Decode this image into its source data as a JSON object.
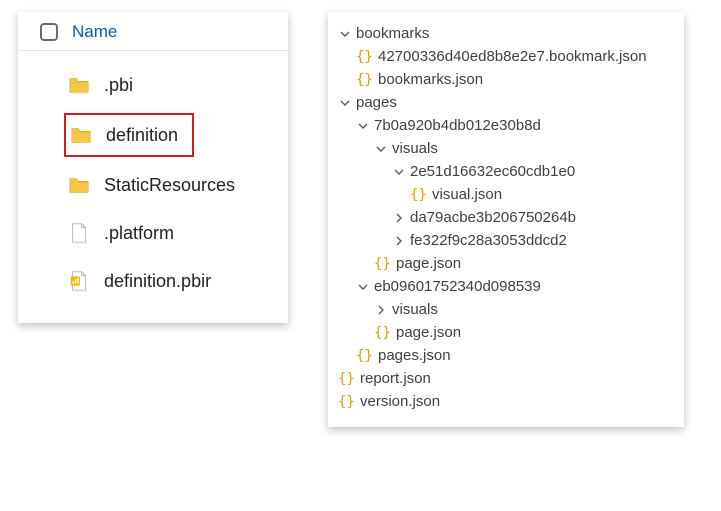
{
  "explorer": {
    "column_header": "Name",
    "items": [
      {
        "name": ".pbi",
        "icon": "folder",
        "highlighted": false
      },
      {
        "name": "definition",
        "icon": "folder",
        "highlighted": true
      },
      {
        "name": "StaticResources",
        "icon": "folder",
        "highlighted": false
      },
      {
        "name": ".platform",
        "icon": "file",
        "highlighted": false
      },
      {
        "name": "definition.pbir",
        "icon": "pbir",
        "highlighted": false
      }
    ]
  },
  "tree": [
    {
      "indent": 0,
      "type": "folder",
      "state": "open",
      "label": "bookmarks"
    },
    {
      "indent": 1,
      "type": "json",
      "label": "42700336d40ed8b8e2e7.bookmark.json"
    },
    {
      "indent": 1,
      "type": "json",
      "label": "bookmarks.json"
    },
    {
      "indent": 0,
      "type": "folder",
      "state": "open",
      "label": "pages"
    },
    {
      "indent": 1,
      "type": "folder",
      "state": "open",
      "label": "7b0a920b4db012e30b8d"
    },
    {
      "indent": 2,
      "type": "folder",
      "state": "open",
      "label": "visuals"
    },
    {
      "indent": 3,
      "type": "folder",
      "state": "open",
      "label": "2e51d16632ec60cdb1e0"
    },
    {
      "indent": 4,
      "type": "json",
      "label": "visual.json"
    },
    {
      "indent": 3,
      "type": "folder",
      "state": "closed",
      "label": "da79acbe3b206750264b"
    },
    {
      "indent": 3,
      "type": "folder",
      "state": "closed",
      "label": "fe322f9c28a3053ddcd2"
    },
    {
      "indent": 2,
      "type": "json",
      "label": "page.json"
    },
    {
      "indent": 1,
      "type": "folder",
      "state": "open",
      "label": "eb09601752340d098539"
    },
    {
      "indent": 2,
      "type": "folder",
      "state": "closed",
      "label": "visuals"
    },
    {
      "indent": 2,
      "type": "json",
      "label": "page.json"
    },
    {
      "indent": 1,
      "type": "json",
      "label": "pages.json"
    },
    {
      "indent": 0,
      "type": "json",
      "label": "report.json"
    },
    {
      "indent": 0,
      "type": "json",
      "label": "version.json"
    }
  ]
}
